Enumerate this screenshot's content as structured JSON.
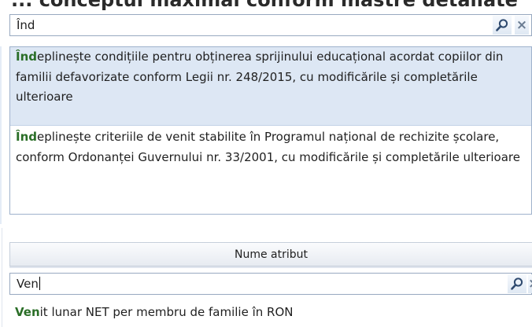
{
  "heading_fragment": "... conceptul maximal conform mastre detaliate",
  "search_top": {
    "query": "Înd",
    "search_icon": "magnifier-icon",
    "clear_icon": "close-icon",
    "clear_label": "×"
  },
  "suggestions": [
    {
      "match": "Înd",
      "rest": "eplinește condițiile pentru obținerea sprijinului educațional acordat copiilor din familii defavorizate conform Legii nr. 248/2015, cu modificările și completările ulterioare",
      "selected": true
    },
    {
      "match": "Înd",
      "rest": "eplinește criteriile de venit stabilite în Programul național de rechizite școlare, conform Ordonanței Guvernului nr. 33/2001, cu modificările și completările ulterioare",
      "selected": false
    }
  ],
  "column_header": "Nume atribut",
  "search_bottom": {
    "query": "Ven",
    "search_icon": "magnifier-icon",
    "clear_icon": "close-icon",
    "clear_label": "×"
  },
  "result": {
    "match": "Ven",
    "rest": "it lunar NET per membru de familie în RON"
  },
  "colors": {
    "highlight": "#2a6e27",
    "selection": "#dde7f4",
    "border": "#98a9c0"
  }
}
